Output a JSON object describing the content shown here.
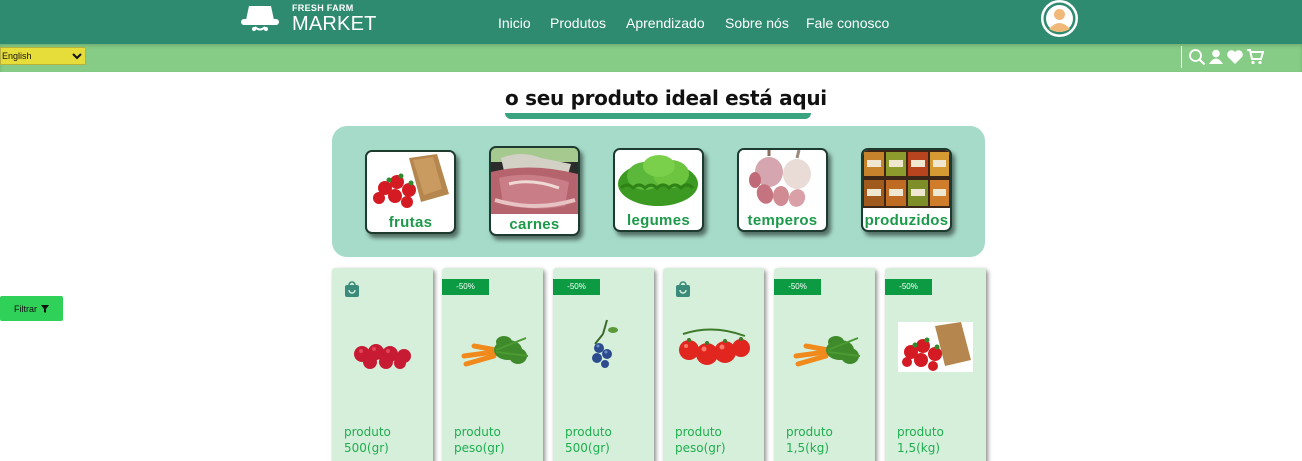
{
  "brand": {
    "line1": "FRESH FARM",
    "line2": "MARKET"
  },
  "nav": [
    "Inicio",
    "Produtos",
    "Aprendizado",
    "Sobre nós",
    "Fale conosco"
  ],
  "language": {
    "selected": "English"
  },
  "toolbar_icons": [
    "search-icon",
    "user-icon",
    "heart-icon",
    "cart-icon"
  ],
  "heading": "o seu produto ideal está aqui",
  "categories": [
    {
      "label": "frutas",
      "icon": "strawberries-image"
    },
    {
      "label": "carnes",
      "icon": "meat-image"
    },
    {
      "label": "legumes",
      "icon": "lettuce-image"
    },
    {
      "label": "temperos",
      "icon": "garlic-image"
    },
    {
      "label": "produzidos",
      "icon": "jars-image"
    }
  ],
  "filter": {
    "label": "Filtrar"
  },
  "products": [
    {
      "badge": "",
      "bag": true,
      "name": "produto",
      "qty": "500(gr)",
      "image": "raspberries"
    },
    {
      "badge": "-50%",
      "bag": false,
      "name": "produto",
      "qty": "peso(gr)",
      "image": "carrots"
    },
    {
      "badge": "-50%",
      "bag": false,
      "name": "produto",
      "qty": "500(gr)",
      "image": "blueberries"
    },
    {
      "badge": "",
      "bag": true,
      "name": "produto",
      "qty": "peso(gr)",
      "image": "tomatoes"
    },
    {
      "badge": "-50%",
      "bag": false,
      "name": "produto",
      "qty": "1,5(kg)",
      "image": "carrots"
    },
    {
      "badge": "-50%",
      "bag": false,
      "name": "produto",
      "qty": "1,5(kg)",
      "image": "strawberries"
    }
  ],
  "colors": {
    "topbar": "#2e8b6f",
    "subbar": "#86cc86",
    "panel": "#a6dbc9",
    "card": "#d6efdb",
    "accent": "#1fae4f"
  }
}
